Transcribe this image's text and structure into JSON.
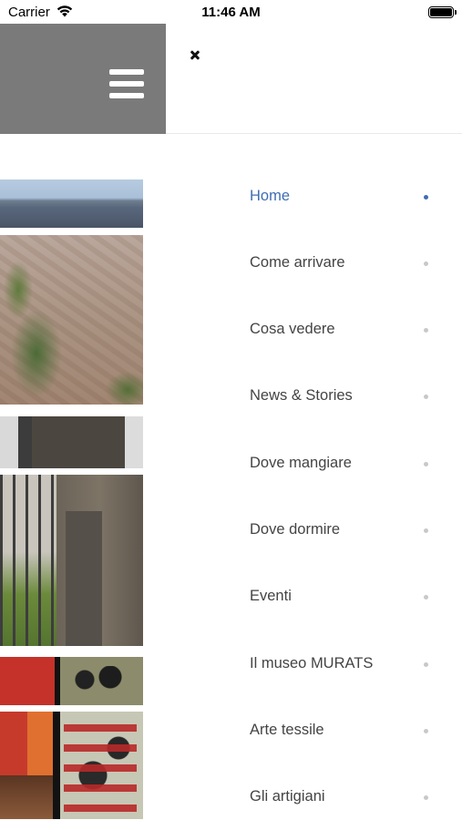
{
  "status_bar": {
    "carrier": "Carrier",
    "time": "11:46 AM"
  },
  "menu": {
    "items": [
      {
        "label": "Home",
        "active": true
      },
      {
        "label": "Come arrivare",
        "active": false
      },
      {
        "label": "Cosa vedere",
        "active": false
      },
      {
        "label": "News & Stories",
        "active": false
      },
      {
        "label": "Dove mangiare",
        "active": false
      },
      {
        "label": "Dove dormire",
        "active": false
      },
      {
        "label": "Eventi",
        "active": false
      },
      {
        "label": "Il museo MURATS",
        "active": false
      },
      {
        "label": "Arte tessile",
        "active": false
      },
      {
        "label": "Gli artigiani",
        "active": false
      }
    ]
  },
  "colors": {
    "accent": "#3f6db1",
    "header_gray": "#7a7a7a",
    "text": "#444444",
    "dot_inactive": "#c8c8c8"
  },
  "icons": {
    "hamburger": "hamburger-menu-icon",
    "close": "close-icon",
    "wifi": "wifi-icon",
    "battery": "battery-icon"
  }
}
